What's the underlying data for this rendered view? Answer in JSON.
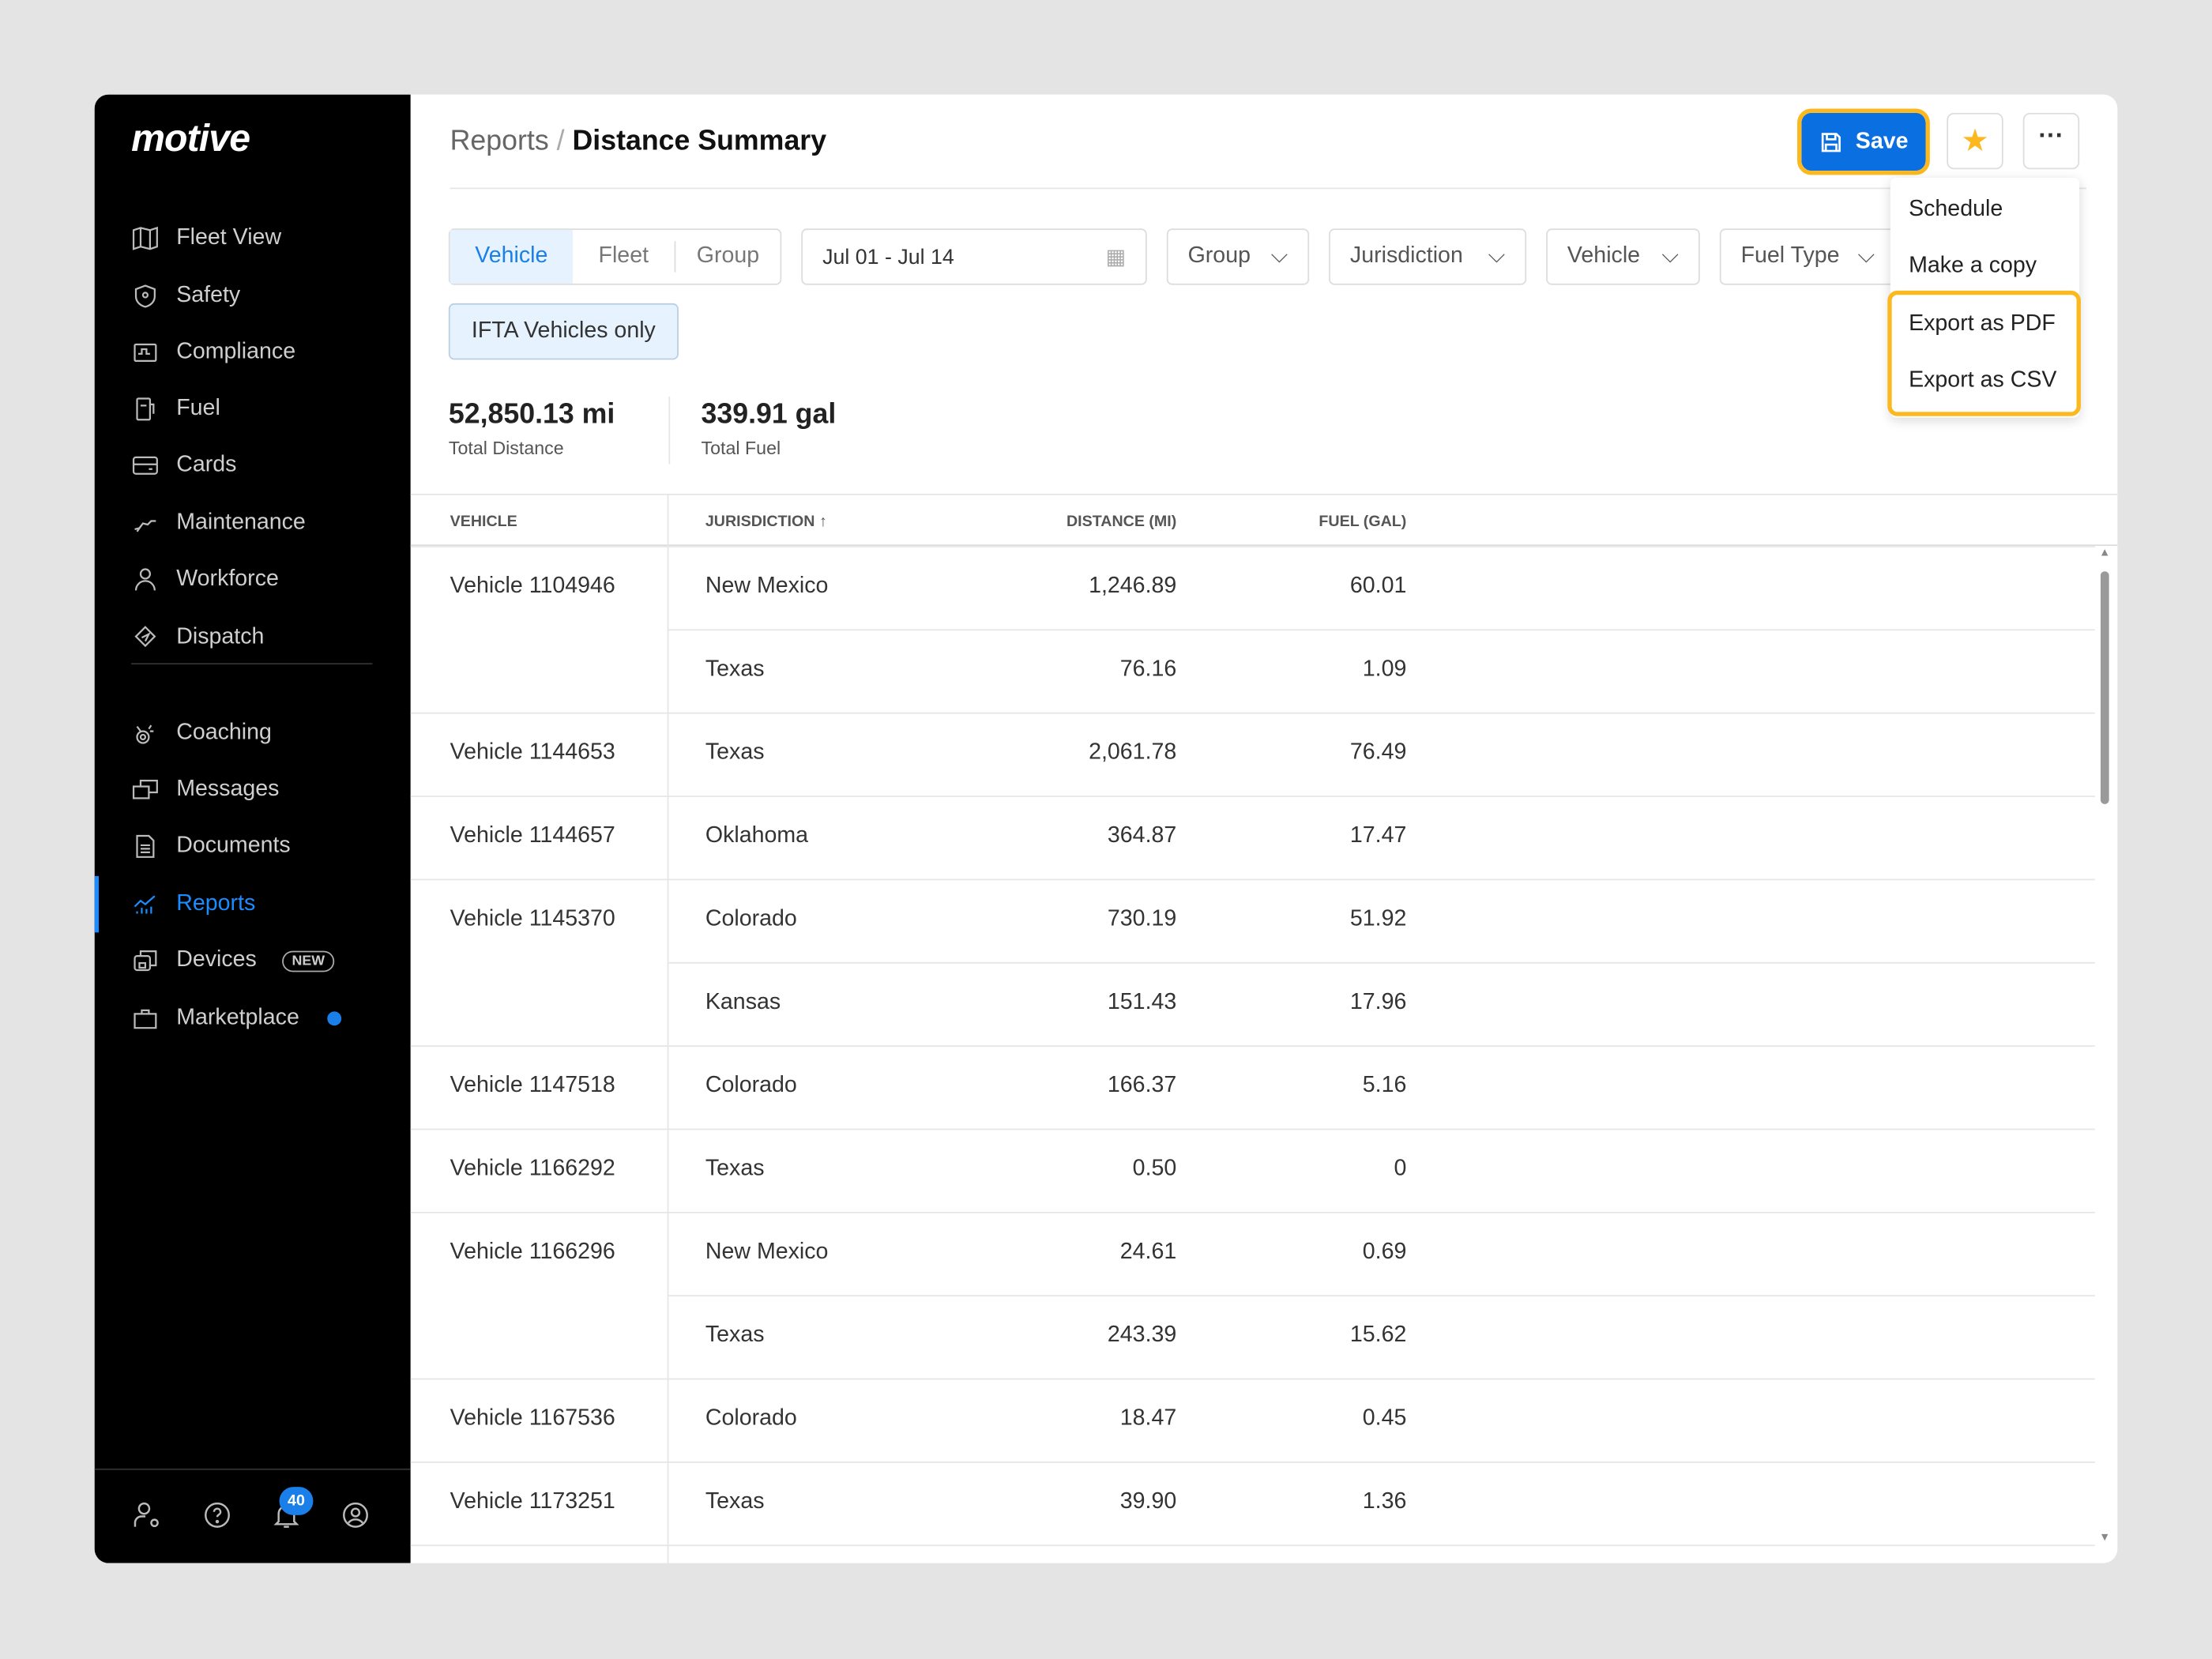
{
  "brand": "motive",
  "sidebar": {
    "items": [
      {
        "label": "Fleet View",
        "icon": "map-icon"
      },
      {
        "label": "Safety",
        "icon": "shield-icon"
      },
      {
        "label": "Compliance",
        "icon": "compliance-icon"
      },
      {
        "label": "Fuel",
        "icon": "fuel-icon"
      },
      {
        "label": "Cards",
        "icon": "card-icon"
      },
      {
        "label": "Maintenance",
        "icon": "wrench-icon"
      },
      {
        "label": "Workforce",
        "icon": "person-icon"
      },
      {
        "label": "Dispatch",
        "icon": "dispatch-icon"
      },
      {
        "label": "Coaching",
        "icon": "coaching-icon"
      },
      {
        "label": "Messages",
        "icon": "messages-icon"
      },
      {
        "label": "Documents",
        "icon": "document-icon"
      },
      {
        "label": "Reports",
        "icon": "reports-icon",
        "active": true
      },
      {
        "label": "Devices",
        "icon": "devices-icon",
        "badge": "NEW"
      },
      {
        "label": "Marketplace",
        "icon": "bag-icon"
      }
    ],
    "notifications": "40"
  },
  "header": {
    "parent": "Reports",
    "separator": "/",
    "title": "Distance Summary",
    "save": "Save"
  },
  "menu": {
    "items": [
      "Schedule",
      "Make a copy",
      "Export as PDF",
      "Export as CSV"
    ]
  },
  "filters": {
    "segments": [
      "Vehicle",
      "Fleet",
      "Group"
    ],
    "date": "Jul 01 - Jul 14",
    "dropdowns": [
      "Group",
      "Jurisdiction",
      "Vehicle",
      "Fuel Type"
    ],
    "ifta": "IFTA Vehicles only"
  },
  "stats": {
    "distance": "52,850.13 mi",
    "distance_label": "Total Distance",
    "fuel": "339.91 gal",
    "fuel_label": "Total Fuel"
  },
  "table": {
    "headers": [
      "VEHICLE",
      "JURISDICTION",
      "DISTANCE (MI)",
      "FUEL (GAL)"
    ],
    "sort_icon": "↑",
    "rows": [
      {
        "vehicle": "Vehicle 1104946",
        "jurisdiction": "New Mexico",
        "distance": "1,246.89",
        "fuel": "60.01"
      },
      {
        "vehicle": "",
        "jurisdiction": "Texas",
        "distance": "76.16",
        "fuel": "1.09"
      },
      {
        "vehicle": "Vehicle 1144653",
        "jurisdiction": "Texas",
        "distance": "2,061.78",
        "fuel": "76.49"
      },
      {
        "vehicle": "Vehicle 1144657",
        "jurisdiction": "Oklahoma",
        "distance": "364.87",
        "fuel": "17.47"
      },
      {
        "vehicle": "Vehicle 1145370",
        "jurisdiction": "Colorado",
        "distance": "730.19",
        "fuel": "51.92"
      },
      {
        "vehicle": "",
        "jurisdiction": "Kansas",
        "distance": "151.43",
        "fuel": "17.96"
      },
      {
        "vehicle": "Vehicle 1147518",
        "jurisdiction": "Colorado",
        "distance": "166.37",
        "fuel": "5.16"
      },
      {
        "vehicle": "Vehicle 1166292",
        "jurisdiction": "Texas",
        "distance": "0.50",
        "fuel": "0"
      },
      {
        "vehicle": "Vehicle 1166296",
        "jurisdiction": "New Mexico",
        "distance": "24.61",
        "fuel": "0.69"
      },
      {
        "vehicle": "",
        "jurisdiction": "Texas",
        "distance": "243.39",
        "fuel": "15.62"
      },
      {
        "vehicle": "Vehicle 1167536",
        "jurisdiction": "Colorado",
        "distance": "18.47",
        "fuel": "0.45"
      },
      {
        "vehicle": "Vehicle 1173251",
        "jurisdiction": "Texas",
        "distance": "39.90",
        "fuel": "1.36"
      }
    ]
  },
  "colors": {
    "accent": "#1a7fe8",
    "highlight": "#fbb91f",
    "sidebar": "#000000"
  }
}
